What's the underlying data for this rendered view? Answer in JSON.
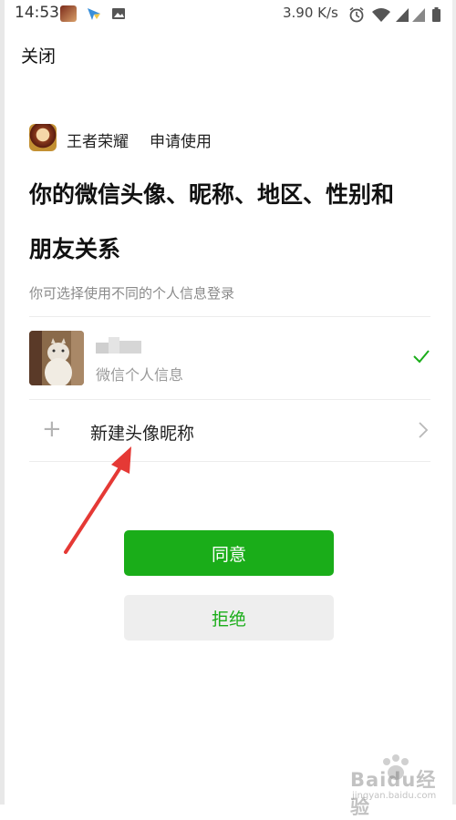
{
  "status_bar": {
    "time": "14:53",
    "network_speed": "3.90 K/s",
    "icons": [
      "game-app-icon",
      "navigation-app-icon",
      "image-app-icon",
      "alarm-icon",
      "wifi-icon",
      "signal-icon",
      "signal-icon-2",
      "battery-icon"
    ]
  },
  "nav": {
    "close_label": "关闭"
  },
  "app": {
    "name": "王者荣耀",
    "request": "申请使用"
  },
  "title_line1": "你的微信头像、昵称、地区、性别和",
  "title_line2": "朋友关系",
  "hint": "你可选择使用不同的个人信息登录",
  "profile_option": {
    "subtitle": "微信个人信息",
    "selected": true
  },
  "new_option": {
    "label": "新建头像昵称"
  },
  "buttons": {
    "agree": "同意",
    "reject": "拒绝"
  },
  "colors": {
    "accent": "#1aad19",
    "annotation_arrow": "#e53935"
  },
  "watermark": {
    "text": "Baidu经验",
    "sub": "jingyan.baidu.com"
  }
}
